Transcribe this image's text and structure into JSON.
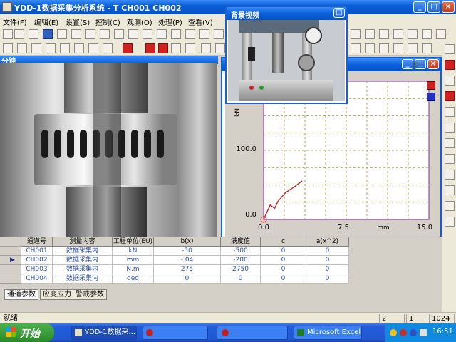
{
  "window": {
    "title": "YDD-1数据采集分析系统 -  T CH001 CH002"
  },
  "menu": [
    "文件(F)",
    "编辑(E)",
    "设置(S)",
    "控制(C)",
    "观测(O)",
    "处理(P)",
    "查看(V)"
  ],
  "image_window": {
    "title": "分钟"
  },
  "video_window": {
    "title": "背景视频"
  },
  "chart": {
    "ylabel": "kN",
    "xlabel": "mm",
    "y_ticks": [
      "0.0",
      "100.0"
    ],
    "x_ticks": [
      "0.0",
      "7.5",
      "15.0"
    ],
    "line_color": "#c02020",
    "chart_data": {
      "type": "line",
      "x": [
        0.0,
        0.6,
        1.0,
        1.3,
        2.0,
        2.8,
        3.5
      ],
      "y": [
        0,
        20,
        15,
        25,
        37,
        45,
        53
      ],
      "xlim": [
        0,
        15
      ],
      "ylim": [
        0,
        190
      ],
      "grid": true
    }
  },
  "table": {
    "headers": [
      "通道号",
      "测量内容",
      "工程单位(EU)",
      "b(x)",
      "满度值",
      "c",
      "a(x^2)"
    ],
    "rows": [
      [
        "CH001",
        "数据采集内",
        "kN",
        "-50",
        "-500",
        "0",
        "0"
      ],
      [
        "CH002",
        "数据采集内",
        "mm",
        "-.04",
        "-200",
        "0",
        "0"
      ],
      [
        "CH003",
        "数据采集内",
        "N.m",
        "275",
        "2750",
        "0",
        "0"
      ],
      [
        "CH004",
        "数据采集内",
        "deg",
        "0",
        "0",
        "0",
        "0"
      ]
    ]
  },
  "tabs": [
    "通道参数",
    "应变应力",
    "警戒参数"
  ],
  "status": {
    "text": "就绪",
    "c1": "2",
    "c2": "1",
    "c3": "1024"
  },
  "taskbar": {
    "start": "开始",
    "items": [
      "YDD-1数据采...",
      "",
      "",
      "Microsoft Excel ..."
    ],
    "clock": "16:51"
  }
}
